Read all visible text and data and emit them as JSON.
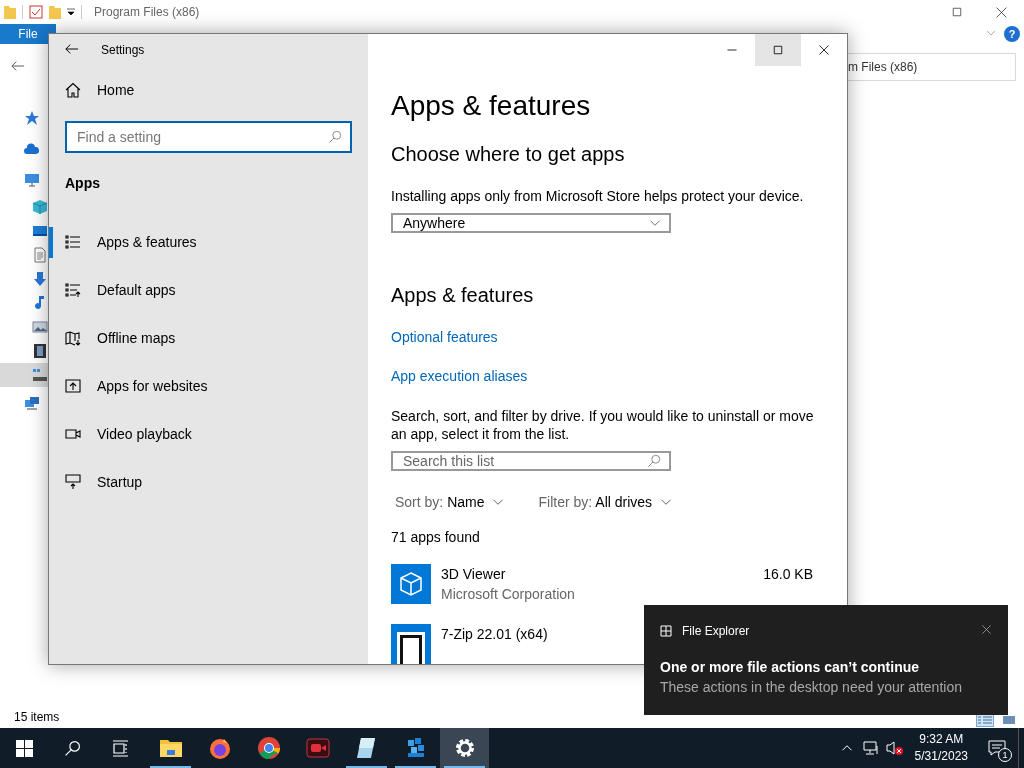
{
  "explorer": {
    "title": "Program Files (x86)",
    "file_tab": "File",
    "help": "?",
    "address": "m Files (x86)",
    "status": "15 items",
    "nav": [
      {
        "kind": "star",
        "selected": false
      },
      {
        "kind": "cloud",
        "selected": false
      },
      {
        "kind": "monitor",
        "selected": false,
        "children": [
          {
            "kind": "cube",
            "selected": false
          },
          {
            "kind": "desktop",
            "selected": false
          },
          {
            "kind": "document",
            "selected": false
          },
          {
            "kind": "download",
            "selected": false
          },
          {
            "kind": "music",
            "selected": false
          },
          {
            "kind": "picture",
            "selected": false
          },
          {
            "kind": "film",
            "selected": false
          },
          {
            "kind": "drive",
            "selected": true
          }
        ]
      },
      {
        "kind": "network",
        "selected": false
      }
    ],
    "views": [
      {
        "kind": "details",
        "selected": true
      },
      {
        "kind": "tiles",
        "selected": false
      }
    ]
  },
  "settings": {
    "title": "Settings",
    "home": "Home",
    "search_placeholder": "Find a setting",
    "section": "Apps",
    "nav_items": [
      {
        "label": "Apps & features",
        "kind": "list",
        "selected": true
      },
      {
        "label": "Default apps",
        "kind": "defaults",
        "selected": false
      },
      {
        "label": "Offline maps",
        "kind": "map",
        "selected": false
      },
      {
        "label": "Apps for websites",
        "kind": "web",
        "selected": false
      },
      {
        "label": "Video playback",
        "kind": "video",
        "selected": false
      },
      {
        "label": "Startup",
        "kind": "startup",
        "selected": false
      }
    ],
    "caption_buttons": [
      {
        "kind": "minimize",
        "hovered": false
      },
      {
        "kind": "maximize",
        "hovered": true
      },
      {
        "kind": "close",
        "hovered": false
      }
    ],
    "content": {
      "heading": "Apps & features",
      "subheading": "Choose where to get apps",
      "description": "Installing apps only from Microsoft Store helps protect your device.",
      "source_dropdown": "Anywhere",
      "section": "Apps & features",
      "links": [
        "Optional features",
        "App execution aliases"
      ],
      "help_text": "Search, sort, and filter by drive. If you would like to uninstall or move an app, select it from the list.",
      "list_search_placeholder": "Search this list",
      "sort_label": "Sort by:",
      "sort_value": "Name",
      "filter_label": "Filter by:",
      "filter_value": "All drives",
      "count": "71 apps found",
      "apps": [
        {
          "name": "3D Viewer",
          "publisher": "Microsoft Corporation",
          "size": "16.0 KB",
          "kind": "cube"
        },
        {
          "name": "7-Zip 22.01 (x64)",
          "kind": "zip"
        }
      ]
    }
  },
  "toast": {
    "app": "File Explorer",
    "title": "One or more file actions can’t continue",
    "body": "These actions in the desktop need your attention"
  },
  "taskbar": {
    "apps": [
      {
        "kind": "folder",
        "running": true,
        "selected": false
      },
      {
        "kind": "firefox",
        "running": false,
        "selected": false
      },
      {
        "kind": "chrome",
        "running": false,
        "selected": false
      },
      {
        "kind": "recorder",
        "running": false,
        "selected": false
      },
      {
        "kind": "glass",
        "running": true,
        "selected": false
      },
      {
        "kind": "blocks",
        "running": true,
        "selected": false
      },
      {
        "kind": "gear",
        "running": true,
        "selected": true
      }
    ],
    "time": "9:32 AM",
    "date": "5/31/2023",
    "notifications": "1"
  }
}
